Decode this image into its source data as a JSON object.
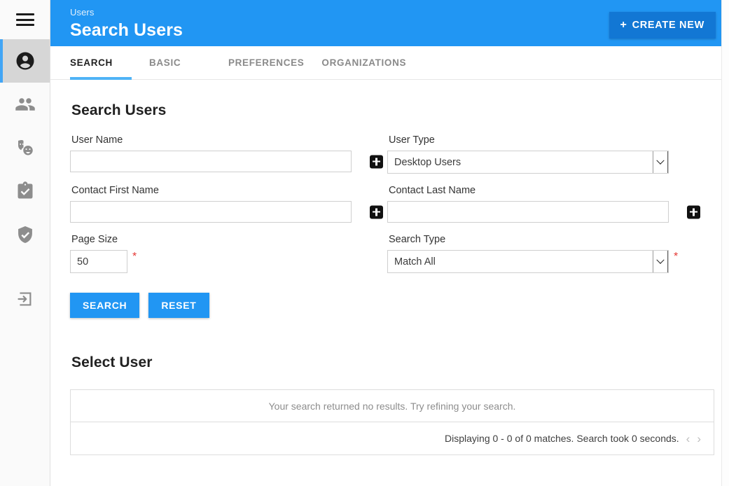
{
  "sidebar": {
    "menu_icon": "hamburger-icon",
    "items": [
      {
        "icon": "account-circle-icon",
        "name": "users",
        "active": true
      },
      {
        "icon": "people-group-icon",
        "name": "groups",
        "active": false
      },
      {
        "icon": "theater-masks-icon",
        "name": "roles",
        "active": false
      },
      {
        "icon": "clipboard-check-icon",
        "name": "tasks",
        "active": false
      },
      {
        "icon": "shield-check-icon",
        "name": "security",
        "active": false
      },
      {
        "icon": "exit-to-app-icon",
        "name": "login",
        "active": false
      }
    ]
  },
  "header": {
    "breadcrumb": "Users",
    "title": "Search Users",
    "create_button": "CREATE NEW",
    "create_button_plus": "+",
    "bg_color": "#2196f3",
    "button_color": "#1277d4"
  },
  "tabs": [
    {
      "label": "SEARCH",
      "active": true
    },
    {
      "label": "BASIC",
      "active": false
    },
    {
      "label": "PREFERENCES",
      "active": false
    },
    {
      "label": "ORGANIZATIONS",
      "active": false
    }
  ],
  "search_form": {
    "heading": "Search Users",
    "fields": {
      "user_name": {
        "label": "User Name",
        "value": "",
        "placeholder": "",
        "addon": "add-icon"
      },
      "user_type": {
        "label": "User Type",
        "value": "Desktop Users",
        "options": [
          "Desktop Users"
        ]
      },
      "contact_first_name": {
        "label": "Contact First Name",
        "value": "",
        "placeholder": "",
        "addon": "add-icon"
      },
      "contact_last_name": {
        "label": "Contact Last Name",
        "value": "",
        "placeholder": "",
        "addon": "add-icon"
      },
      "page_size": {
        "label": "Page Size",
        "value": "50",
        "required_marker": "*"
      },
      "search_type": {
        "label": "Search Type",
        "value": "Match All",
        "required_marker": "*",
        "options": [
          "Match All"
        ]
      }
    },
    "buttons": {
      "search": "SEARCH",
      "reset": "RESET"
    }
  },
  "results": {
    "heading": "Select User",
    "empty_message": "Your search returned no results. Try refining your search.",
    "status": "Displaying 0 - 0 of 0 matches. Search took 0 seconds.",
    "prev_arrow": "‹",
    "next_arrow": "›"
  }
}
